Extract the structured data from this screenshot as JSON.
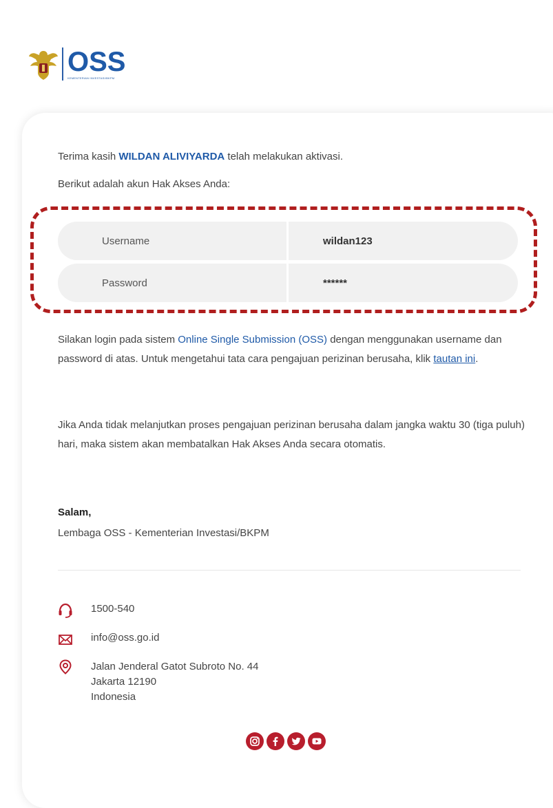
{
  "header": {
    "logo_text": "OSS",
    "logo_subtext": "KEMENTERIAN INVESTASI/BKPM"
  },
  "message": {
    "greeting_prefix": "Terima kasih ",
    "user_name": "WILDAN ALIVIYARDA",
    "greeting_suffix": " telah melakukan aktivasi.",
    "account_intro": "Berikut adalah akun Hak Akses Anda:"
  },
  "credentials": {
    "username_label": "Username",
    "username_value": "wildan123",
    "password_label": "Password",
    "password_value": "******"
  },
  "body": {
    "para1_a": "Silakan login pada sistem ",
    "para1_link": "Online Single Submission (OSS)",
    "para1_b": " dengan menggunakan username dan password di atas. Untuk mengetahui tata cara pengajuan perizinan berusaha, klik ",
    "para1_tautan": "tautan ini",
    "para1_c": ".",
    "para2": "Jika Anda tidak melanjutkan proses pengajuan perizinan berusaha dalam jangka waktu 30 (tiga puluh) hari, maka sistem akan membatalkan Hak Akses Anda secara otomatis."
  },
  "signature": {
    "salam": "Salam,",
    "organization": "Lembaga OSS - Kementerian Investasi/BKPM"
  },
  "contact": {
    "phone": "1500-540",
    "email": "info@oss.go.id",
    "address_line1": "Jalan Jenderal Gatot Subroto No. 44",
    "address_line2": "Jakarta 12190",
    "address_line3": "Indonesia"
  },
  "social": {
    "icons": [
      "instagram-icon",
      "facebook-icon",
      "twitter-icon",
      "youtube-icon"
    ]
  },
  "colors": {
    "brand_blue": "#1f5aa8",
    "accent_red": "#b81e2d",
    "dashed_highlight": "#b01e1e"
  }
}
